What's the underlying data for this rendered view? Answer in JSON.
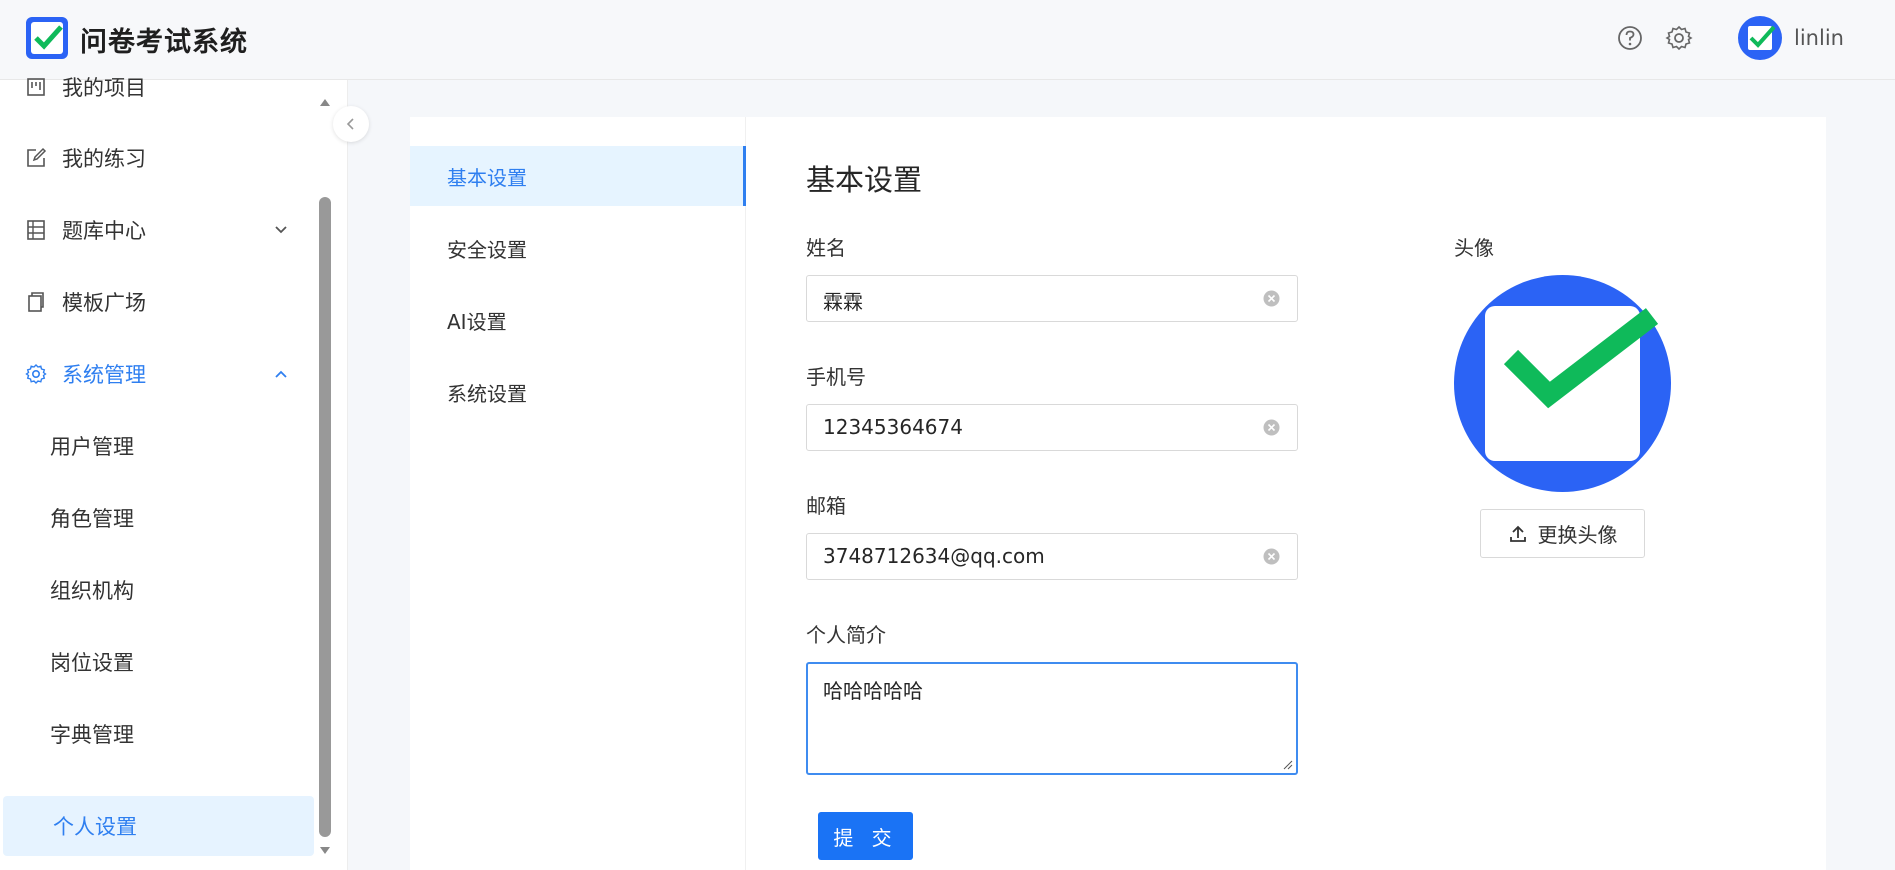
{
  "header": {
    "app_title": "问卷考试系统",
    "username": "linlin"
  },
  "sidebar": {
    "items": [
      {
        "label": "我的项目",
        "icon": "board-icon"
      },
      {
        "label": "我的练习",
        "icon": "edit-icon"
      },
      {
        "label": "题库中心",
        "icon": "list-icon"
      },
      {
        "label": "模板广场",
        "icon": "copy-icon"
      },
      {
        "label": "系统管理",
        "icon": "gear-icon"
      }
    ],
    "submenu": [
      {
        "label": "用户管理"
      },
      {
        "label": "角色管理"
      },
      {
        "label": "组织机构"
      },
      {
        "label": "岗位设置"
      },
      {
        "label": "字典管理"
      },
      {
        "label": "个人设置"
      }
    ]
  },
  "settings_nav": {
    "items": [
      {
        "label": "基本设置"
      },
      {
        "label": "安全设置"
      },
      {
        "label": "AI设置"
      },
      {
        "label": "系统设置"
      }
    ]
  },
  "form": {
    "title": "基本设置",
    "name_label": "姓名",
    "name_value": "霖霖",
    "phone_label": "手机号",
    "phone_value": "12345364674",
    "email_label": "邮箱",
    "email_value": "3748712634@qq.com",
    "bio_label": "个人简介",
    "bio_value": "哈哈哈哈哈",
    "submit_label": "提 交"
  },
  "avatar": {
    "label": "头像",
    "change_label": "更换头像"
  },
  "colors": {
    "accent": "#2f7ff0",
    "brand_blue": "#2b63f5",
    "check_green": "#0fba5a"
  }
}
